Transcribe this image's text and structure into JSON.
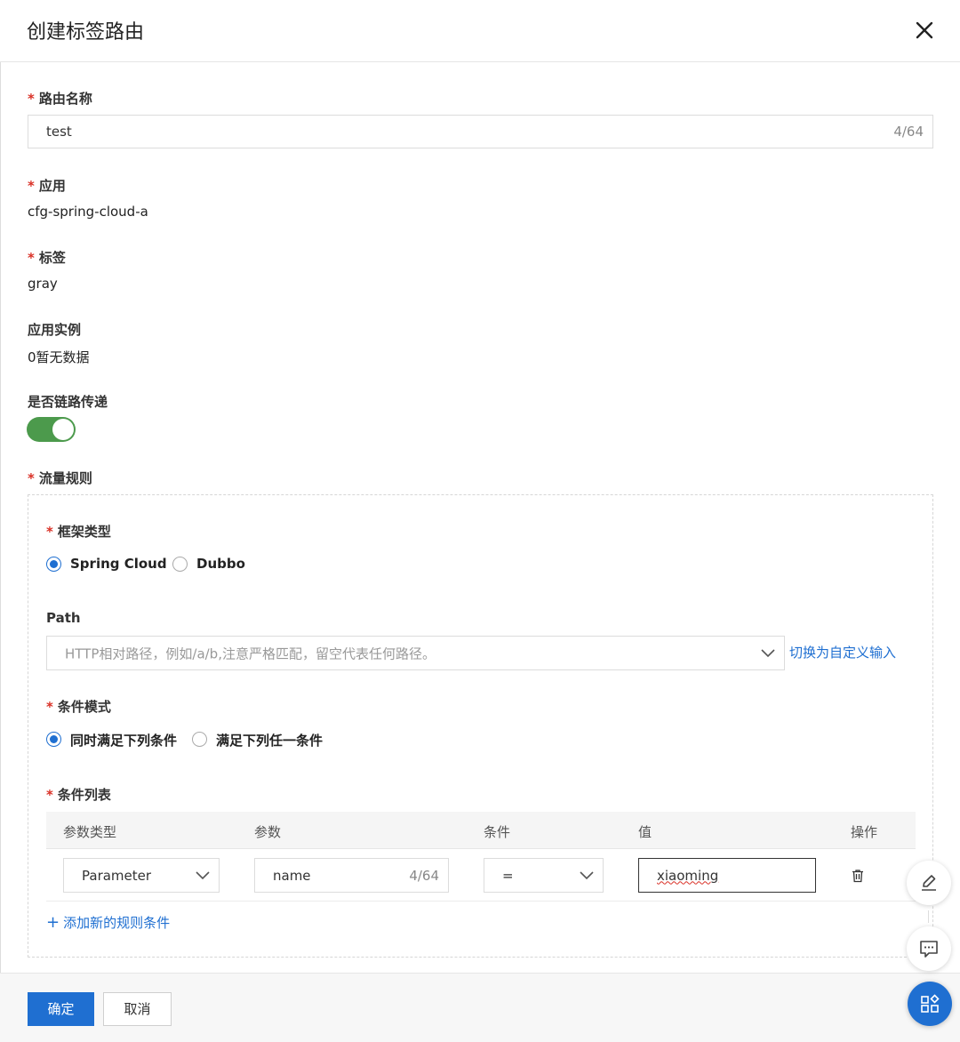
{
  "header": {
    "title": "创建标签路由"
  },
  "route_name": {
    "label": "路由名称",
    "value": "test",
    "count": "4/64"
  },
  "app": {
    "label": "应用",
    "value": "cfg-spring-cloud-a"
  },
  "tag": {
    "label": "标签",
    "value": "gray"
  },
  "instances": {
    "label": "应用实例",
    "value": "0暂无数据"
  },
  "chain": {
    "label": "是否链路传递",
    "enabled": true
  },
  "traffic_rules": {
    "label": "流量规则",
    "framework": {
      "label": "框架类型",
      "options": [
        "Spring Cloud",
        "Dubbo"
      ],
      "selected": "Spring Cloud"
    },
    "path": {
      "label": "Path",
      "placeholder": "HTTP相对路径，例如/a/b,注意严格匹配，留空代表任何路径。",
      "switch_link": "切换为自定义输入"
    },
    "condition_mode": {
      "label": "条件模式",
      "options": [
        "同时满足下列条件",
        "满足下列任一条件"
      ],
      "selected": "同时满足下列条件"
    },
    "condition_list": {
      "label": "条件列表",
      "columns": [
        "参数类型",
        "参数",
        "条件",
        "值",
        "操作"
      ],
      "rows": [
        {
          "param_type": "Parameter",
          "param": "name",
          "param_count": "4/64",
          "operator": "=",
          "value": "xiaoming"
        }
      ],
      "add_link": "添加新的规则条件"
    }
  },
  "footer": {
    "confirm": "确定",
    "cancel": "取消"
  },
  "colors": {
    "primary": "#1f6fd1",
    "switch_on": "#4c9a4c",
    "required": "#d93026"
  }
}
